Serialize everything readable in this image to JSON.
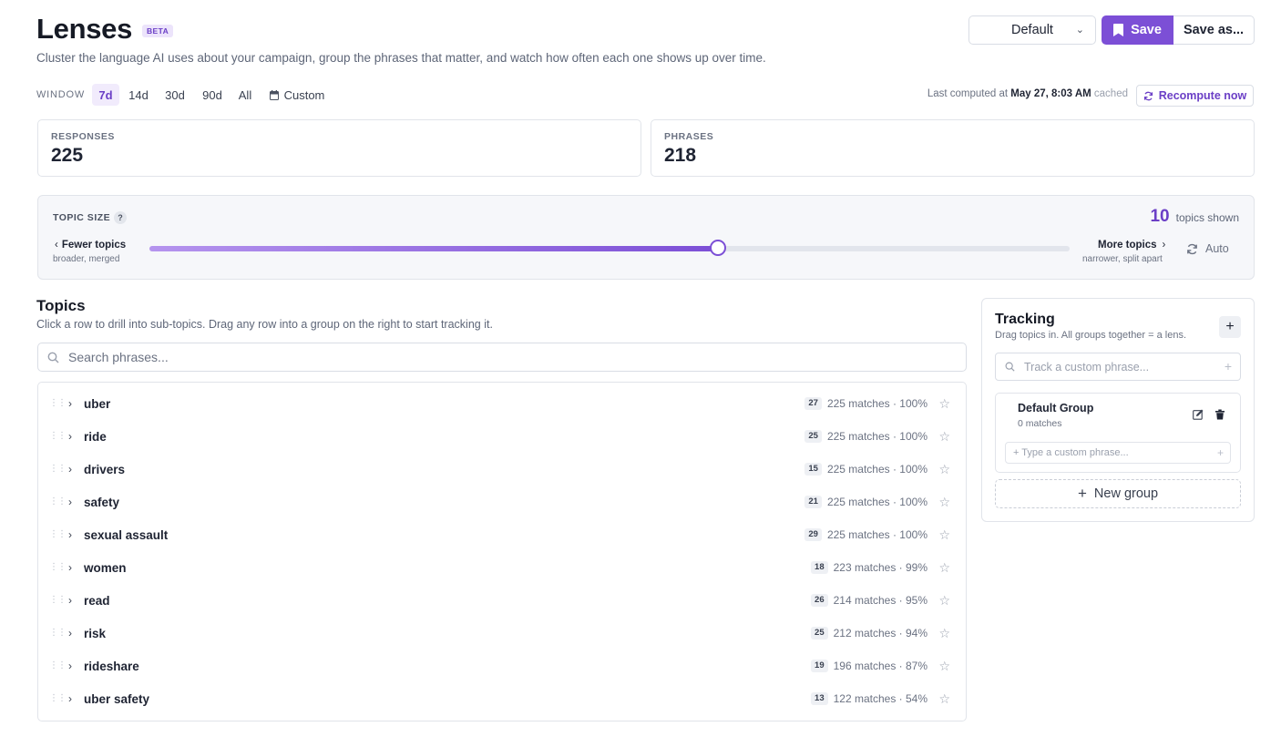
{
  "header": {
    "title": "Lenses",
    "badge": "BETA",
    "subtitle": "Cluster the language AI uses about your campaign, group the phrases that matter, and watch how often each one shows up over time.",
    "preset": "Default",
    "save_label": "Save",
    "save_as_label": "Save as..."
  },
  "window": {
    "label": "WINDOW",
    "options": [
      "7d",
      "14d",
      "30d",
      "90d",
      "All"
    ],
    "custom_label": "Custom",
    "active": "7d",
    "last_computed_label": "Last computed at",
    "last_computed_value": "May 27, 8:03 AM",
    "cached_label": "cached",
    "recompute_label": "Recompute now"
  },
  "stats": {
    "responses_label": "RESPONSES",
    "responses_value": "225",
    "phrases_label": "PHRASES",
    "phrases_value": "218"
  },
  "topic_size": {
    "label": "TOPIC SIZE",
    "help": "?",
    "count": "10",
    "count_label": "topics shown",
    "fewer_label": "Fewer topics",
    "fewer_sub": "broader, merged",
    "more_label": "More topics",
    "more_sub": "narrower, split apart",
    "auto_label": "Auto",
    "slider_value": 0.618
  },
  "topics": {
    "title": "Topics",
    "description": "Click a row to drill into sub-topics. Drag any row into a group on the right to start tracking it.",
    "search_placeholder": "Search phrases...",
    "rows": [
      {
        "name": "uber",
        "count": "27",
        "matches": "225 matches · 100%"
      },
      {
        "name": "ride",
        "count": "25",
        "matches": "225 matches · 100%"
      },
      {
        "name": "drivers",
        "count": "15",
        "matches": "225 matches · 100%"
      },
      {
        "name": "safety",
        "count": "21",
        "matches": "225 matches · 100%"
      },
      {
        "name": "sexual assault",
        "count": "29",
        "matches": "225 matches · 100%"
      },
      {
        "name": "women",
        "count": "18",
        "matches": "223 matches · 99%"
      },
      {
        "name": "read",
        "count": "26",
        "matches": "214 matches · 95%"
      },
      {
        "name": "risk",
        "count": "25",
        "matches": "212 matches · 94%"
      },
      {
        "name": "rideshare",
        "count": "19",
        "matches": "196 matches · 87%"
      },
      {
        "name": "uber safety",
        "count": "13",
        "matches": "122 matches · 54%"
      }
    ]
  },
  "tracking": {
    "title": "Tracking",
    "description": "Drag topics in. All groups together = a lens.",
    "add_label": "+",
    "custom_placeholder": "Track a custom phrase...",
    "group": {
      "name": "Default Group",
      "matches": "0 matches",
      "input_placeholder": "+ Type a custom phrase..."
    },
    "new_group_label": "New group"
  },
  "colors": {
    "accent": "#7c4fd6",
    "accent_light": "#f1ebfc"
  }
}
